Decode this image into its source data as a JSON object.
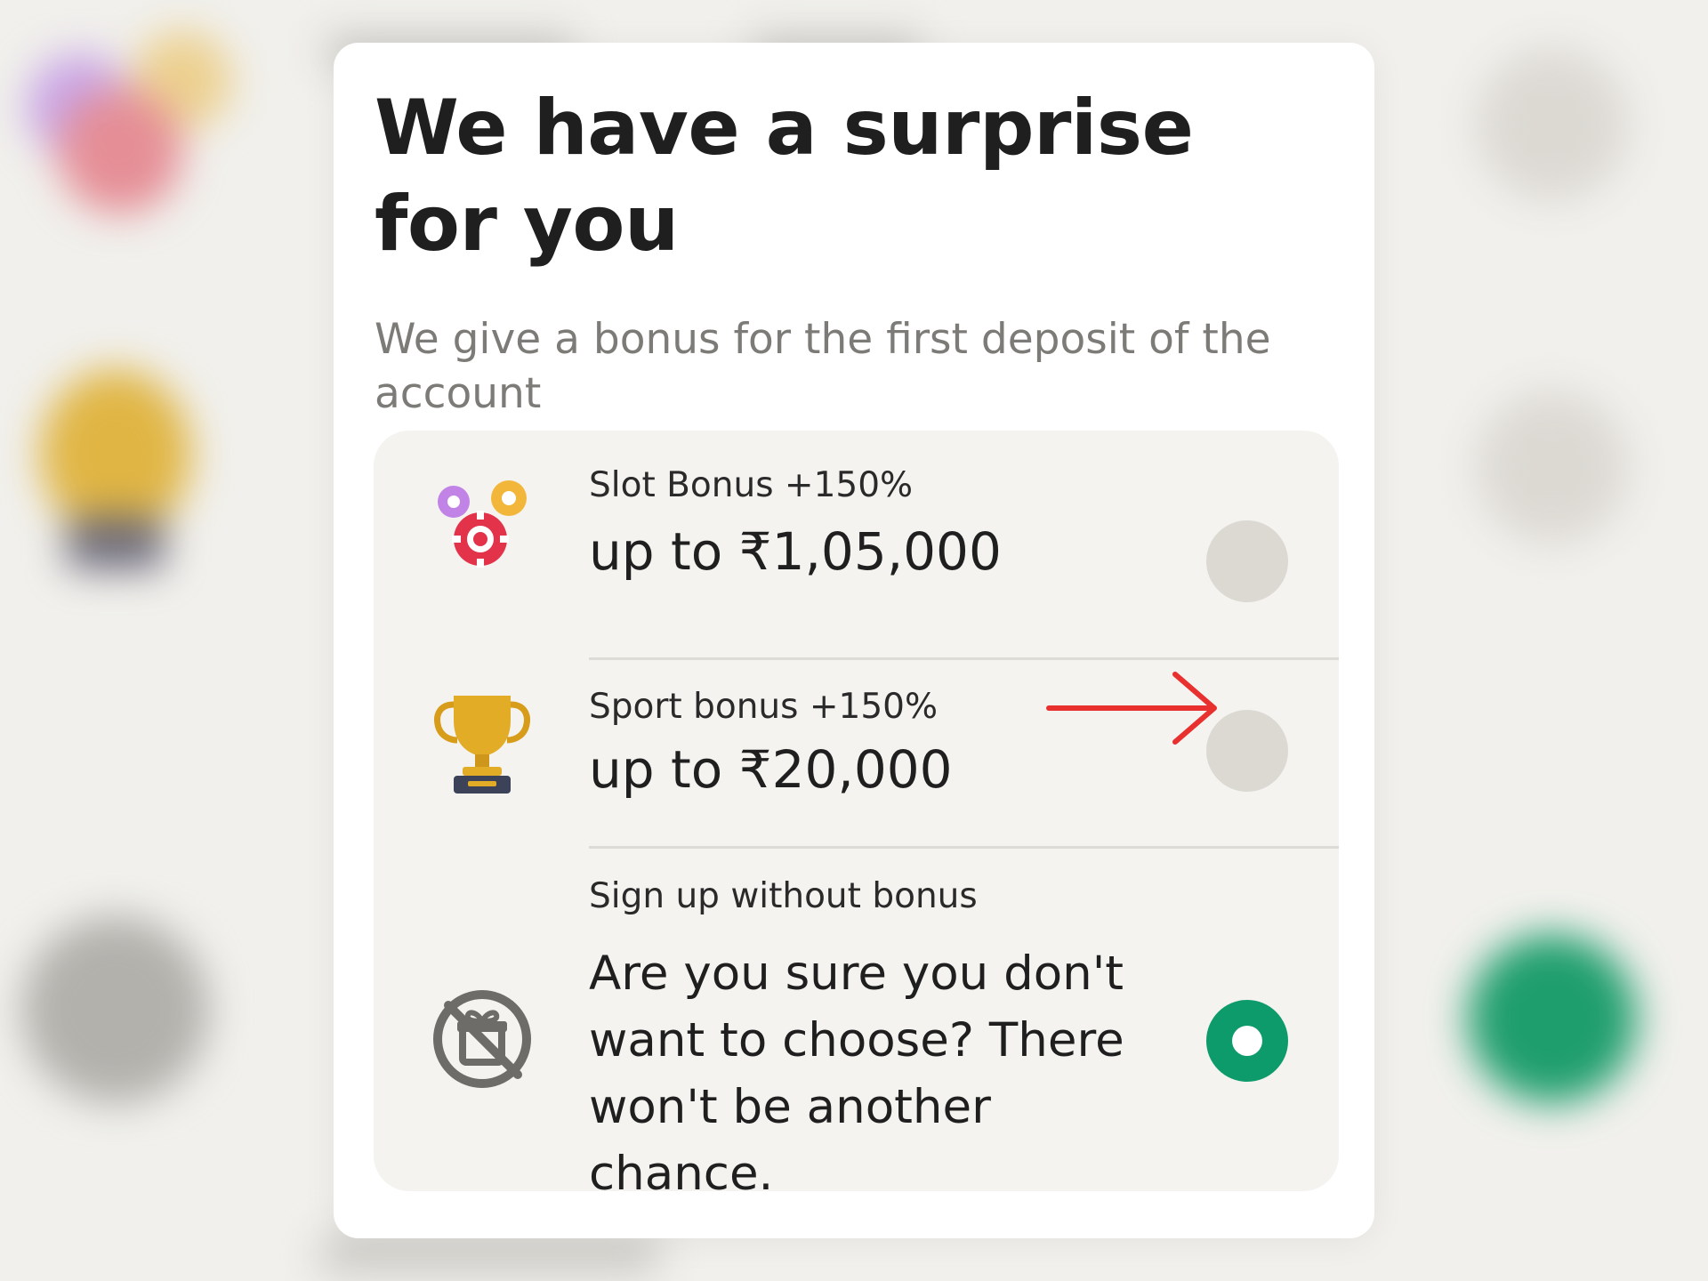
{
  "modal": {
    "title": "We have a surprise for you",
    "subtitle": "We give a bonus for the first deposit of the account"
  },
  "options": [
    {
      "icon": "casino-chips-icon",
      "label": "Slot Bonus +150%",
      "value": "up to ₹1,05,000",
      "selected": false
    },
    {
      "icon": "trophy-icon",
      "label": "Sport bonus +150%",
      "value": "up to ₹20,000",
      "selected": false
    },
    {
      "icon": "no-gift-icon",
      "label": "Sign up without bonus",
      "value": "Are you sure you don't want to choose? There won't be another chance.",
      "selected": true
    }
  ],
  "colors": {
    "selected_radio": "#0e9b6b",
    "unselected_radio": "#dcd9d3",
    "annotation_arrow": "#e8302f",
    "backdrop": "#f1f0ec"
  }
}
